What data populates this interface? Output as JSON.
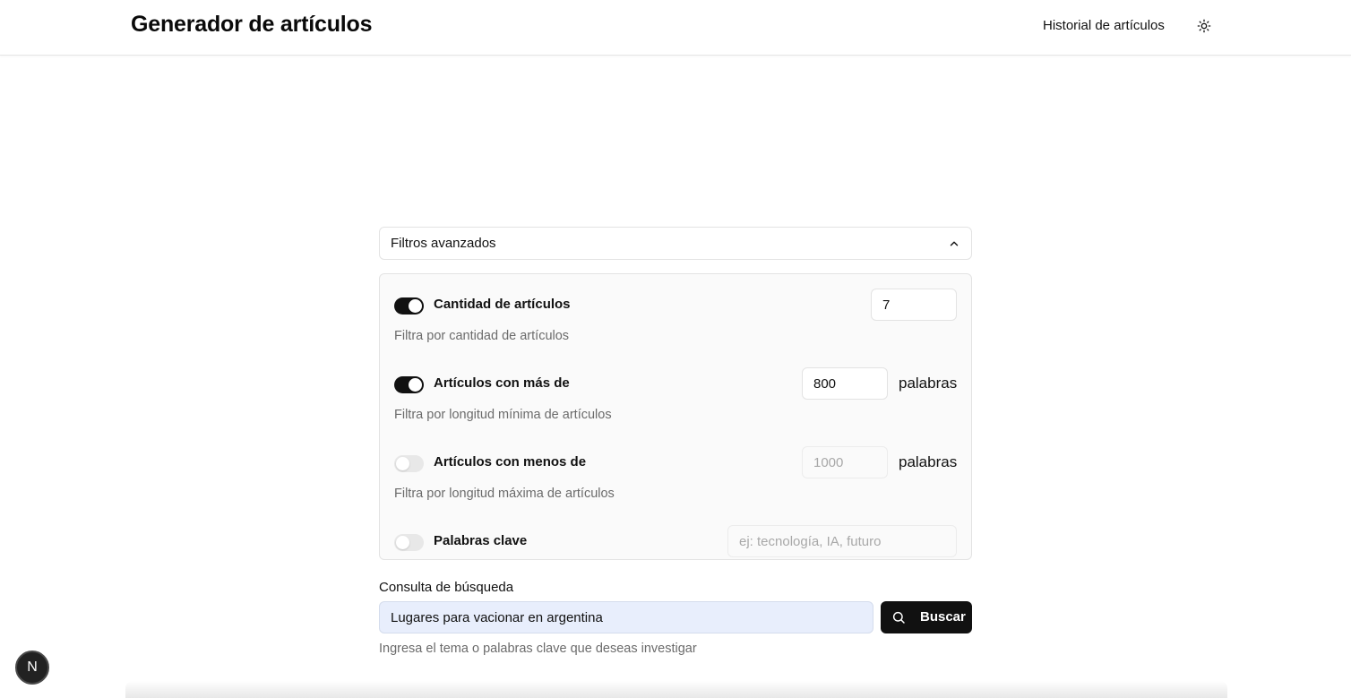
{
  "header": {
    "title": "Generador de artículos",
    "history_link": "Historial de artículos",
    "theme_icon": "sun-icon"
  },
  "filters": {
    "toggle_label": "Filtros avanzados",
    "expanded": true,
    "items": [
      {
        "label": "Cantidad de artículos",
        "description": "Filtra por cantidad de artículos",
        "enabled": true,
        "value": "7",
        "placeholder": "",
        "unit": ""
      },
      {
        "label": "Artículos con más de",
        "description": "Filtra por longitud mínima de artículos",
        "enabled": true,
        "value": "800",
        "placeholder": "",
        "unit": "palabras"
      },
      {
        "label": "Artículos con menos de",
        "description": "Filtra por longitud máxima de artículos",
        "enabled": false,
        "value": "",
        "placeholder": "1000",
        "unit": "palabras"
      },
      {
        "label": "Palabras clave",
        "description": "",
        "enabled": false,
        "value": "",
        "placeholder": "ej: tecnología, IA, futuro",
        "unit": ""
      }
    ]
  },
  "search": {
    "label": "Consulta de búsqueda",
    "value": "Lugares para vacionar en argentina",
    "button_label": "Buscar",
    "help_text": "Ingresa el tema o palabras clave que deseas investigar"
  },
  "dev_badge": {
    "text": "N"
  },
  "colors": {
    "primary": "#111111",
    "muted_text": "#6b6b6b",
    "input_autofill_bg": "#e8eefc",
    "panel_bg": "#fafafa",
    "border": "#e3e3e3"
  }
}
